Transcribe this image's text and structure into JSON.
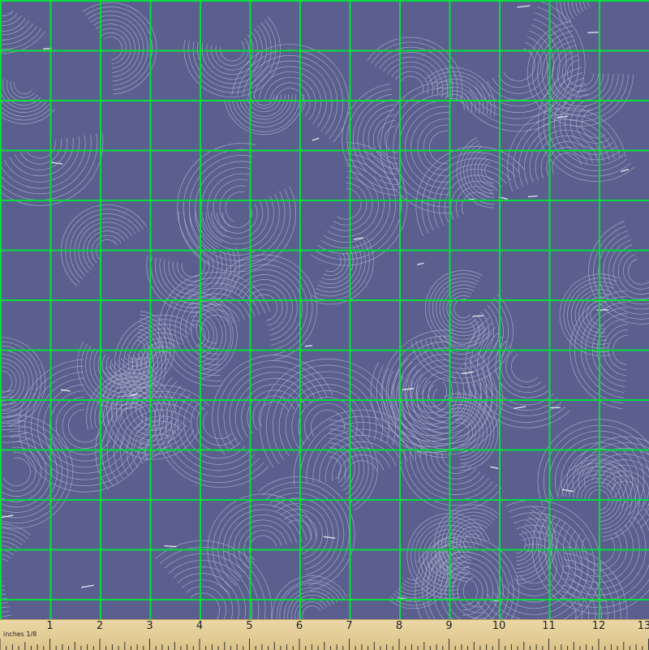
{
  "pattern": {
    "background_color": "#5a5f8e",
    "line_color": "#dfe2f2",
    "grid_color": "#00e03a",
    "motif": "overlapping-fan-arcs"
  },
  "ruler": {
    "unit_label": "inches 1/8",
    "numbers": [
      "1",
      "2",
      "3",
      "4",
      "5",
      "6",
      "7",
      "8",
      "9",
      "10",
      "11",
      "12",
      "13"
    ],
    "color": "#e4cf9a"
  }
}
